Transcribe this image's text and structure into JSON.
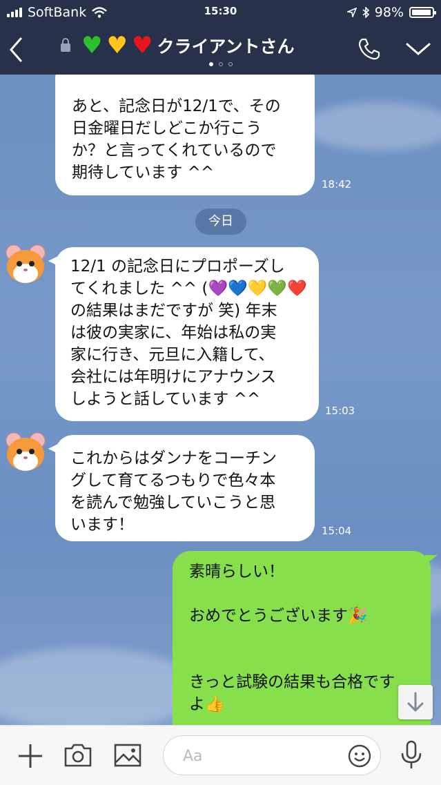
{
  "status": {
    "carrier": "SoftBank",
    "time": "15:30",
    "battery": "98%"
  },
  "header": {
    "title": "クライアントさん",
    "hearts": [
      "♥",
      "♥",
      "♥"
    ]
  },
  "messages": [
    {
      "side": "in",
      "text": "あと、記念日が12/1で、その\n日金曜日だしどこか行こう\nか？と言ってくれているので\n期待しています ^^",
      "time": "18:42"
    },
    {
      "side": "in",
      "text": "12/1 の記念日にプロポーズし\nてくれました ^^ (💜💙💛💚❤️\nの結果はまだですが 笑) 年末\nは彼の実家に、年始は私の実\n家に行き、元旦に入籍して、\n会社には年明けにアナウンス\nしようと話しています ^^",
      "time": "15:03"
    },
    {
      "side": "in",
      "text": "これからはダンナをコーチン\nグして育てるつもりで色々本\nを読んで勉強していこうと思\nいます！",
      "time": "15:04"
    },
    {
      "side": "out",
      "text": "素晴らしい！\n\nおめでとうございます🎉\n\n\nきっと試験の結果も合格です\nよ👍",
      "time": ""
    }
  ],
  "date_separator": "今日",
  "input": {
    "placeholder": "Aa"
  },
  "icons": {
    "back": "chevron-left-icon",
    "phone": "phone-icon",
    "menu": "chevron-down-icon",
    "plus": "plus-icon",
    "camera": "camera-icon",
    "image": "image-icon",
    "emoji": "smiley-icon",
    "mic": "mic-icon",
    "scroll": "arrow-down-icon"
  },
  "colors": {
    "header_bg": "#27314a",
    "outgoing": "#86df4b",
    "incoming": "#ffffff",
    "chat_bg": "#6f93c4"
  }
}
